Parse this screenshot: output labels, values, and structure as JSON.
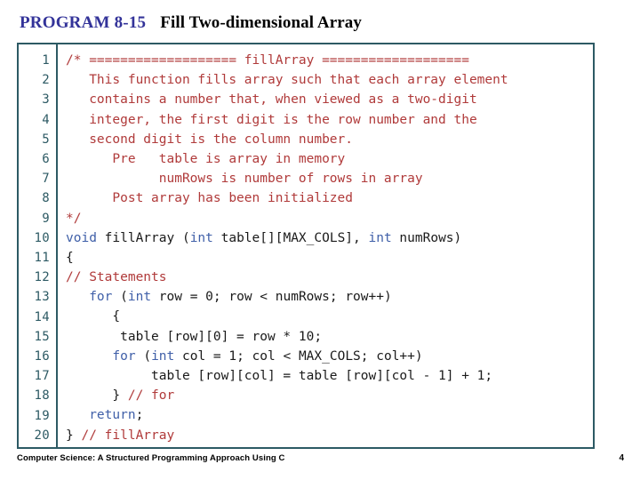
{
  "header": {
    "program_label": "PROGRAM 8-15",
    "program_title": "Fill Two-dimensional Array",
    "label_color": "#333399",
    "title_color": "#000000"
  },
  "code_box": {
    "border_color": "#2d5a64",
    "comment_color": "#b03a3a",
    "keyword_color": "#3f5fa8",
    "plain_color": "#1a1a1a",
    "line_number_color": "#2d5a64",
    "line_numbers": [
      "1",
      "2",
      "3",
      "4",
      "5",
      "6",
      "7",
      "8",
      "9",
      "10",
      "11",
      "12",
      "13",
      "14",
      "15",
      "16",
      "17",
      "18",
      "19",
      "20"
    ],
    "lines": [
      {
        "n": "1",
        "segments": [
          {
            "t": "/* =================== fillArray ===================",
            "c": "cmt"
          }
        ]
      },
      {
        "n": "2",
        "segments": [
          {
            "t": "   This function fills array such that each array element",
            "c": "cmt"
          }
        ]
      },
      {
        "n": "3",
        "segments": [
          {
            "t": "   contains a number that, when viewed as a two-digit",
            "c": "cmt"
          }
        ]
      },
      {
        "n": "4",
        "segments": [
          {
            "t": "   integer, the first digit is the row number and the",
            "c": "cmt"
          }
        ]
      },
      {
        "n": "5",
        "segments": [
          {
            "t": "   second digit is the column number.",
            "c": "cmt"
          }
        ]
      },
      {
        "n": "6",
        "segments": [
          {
            "t": "      Pre   table is array in memory",
            "c": "cmt"
          }
        ]
      },
      {
        "n": "7",
        "segments": [
          {
            "t": "            numRows is number of rows in array",
            "c": "cmt"
          }
        ]
      },
      {
        "n": "8",
        "segments": [
          {
            "t": "      Post array has been initialized",
            "c": "cmt"
          }
        ]
      },
      {
        "n": "9",
        "segments": [
          {
            "t": "*/",
            "c": "cmt"
          }
        ]
      },
      {
        "n": "10",
        "segments": [
          {
            "t": "void",
            "c": "kw"
          },
          {
            "t": " fillArray (",
            "c": "pln"
          },
          {
            "t": "int",
            "c": "kw"
          },
          {
            "t": " table[][MAX_COLS], ",
            "c": "pln"
          },
          {
            "t": "int",
            "c": "kw"
          },
          {
            "t": " numRows)",
            "c": "pln"
          }
        ]
      },
      {
        "n": "11",
        "segments": [
          {
            "t": "{",
            "c": "pln"
          }
        ]
      },
      {
        "n": "12",
        "segments": [
          {
            "t": "// Statements",
            "c": "cmt"
          }
        ]
      },
      {
        "n": "13",
        "segments": [
          {
            "t": "   ",
            "c": "pln"
          },
          {
            "t": "for",
            "c": "kw"
          },
          {
            "t": " (",
            "c": "pln"
          },
          {
            "t": "int",
            "c": "kw"
          },
          {
            "t": " row = 0; row < numRows; row++)",
            "c": "pln"
          }
        ]
      },
      {
        "n": "14",
        "segments": [
          {
            "t": "      {",
            "c": "pln"
          }
        ]
      },
      {
        "n": "15",
        "segments": [
          {
            "t": "       table [row][0] = row * 10;",
            "c": "pln"
          }
        ]
      },
      {
        "n": "16",
        "segments": [
          {
            "t": "      ",
            "c": "pln"
          },
          {
            "t": "for",
            "c": "kw"
          },
          {
            "t": " (",
            "c": "pln"
          },
          {
            "t": "int",
            "c": "kw"
          },
          {
            "t": " col = 1; col < MAX_COLS; col++)",
            "c": "pln"
          }
        ]
      },
      {
        "n": "17",
        "segments": [
          {
            "t": "           table [row][col] = table [row][col - 1] + 1;",
            "c": "pln"
          }
        ]
      },
      {
        "n": "18",
        "segments": [
          {
            "t": "      } ",
            "c": "pln"
          },
          {
            "t": "// for",
            "c": "cmt"
          }
        ]
      },
      {
        "n": "19",
        "segments": [
          {
            "t": "   ",
            "c": "pln"
          },
          {
            "t": "return",
            "c": "kw"
          },
          {
            "t": ";",
            "c": "pln"
          }
        ]
      },
      {
        "n": "20",
        "segments": [
          {
            "t": "} ",
            "c": "pln"
          },
          {
            "t": "// fillArray",
            "c": "cmt"
          }
        ]
      }
    ]
  },
  "footer": {
    "text": "Computer Science: A Structured Programming Approach Using C",
    "page_number": "4"
  }
}
